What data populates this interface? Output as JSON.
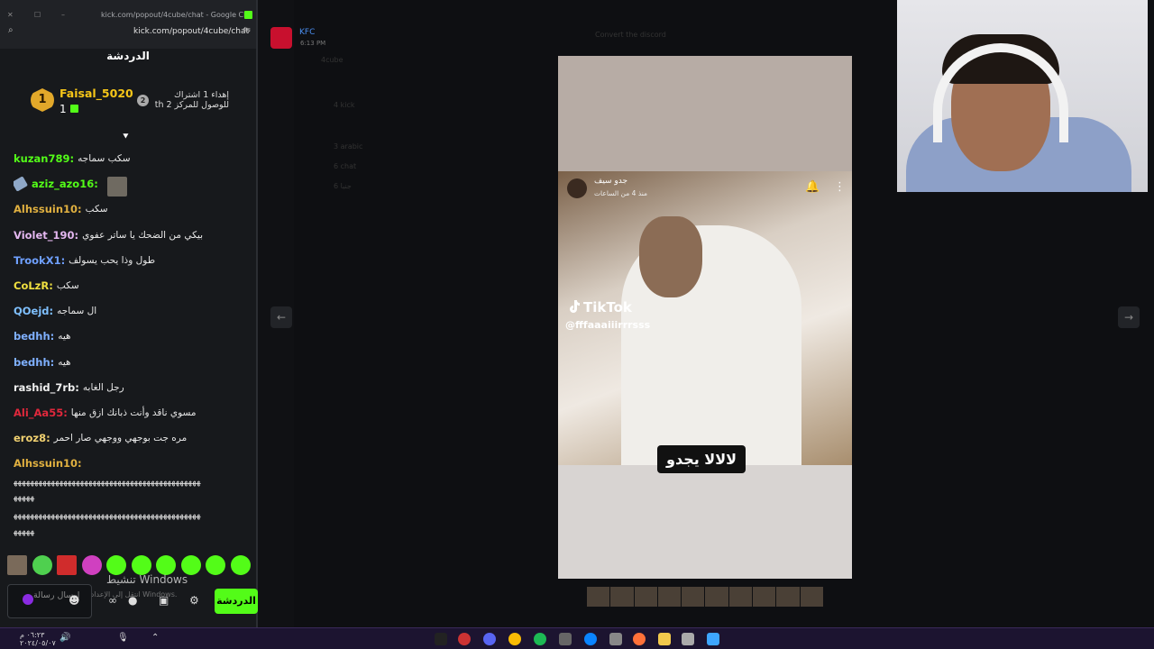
{
  "browser": {
    "window_title": "kick.com/popout/4cube/chat - Google Chrome",
    "url": "kick.com/popout/4cube/chat",
    "zoom_icon": "zoom-icon",
    "extension_icon": "extension-icon"
  },
  "chat": {
    "header": "الدردشة",
    "leader": {
      "rank": "1",
      "name": "Faisal_5020",
      "count": "1"
    },
    "gift_rank": "2",
    "gift_text": "إهداء 1 اشتراك للوصول للمركز 2 th",
    "messages": [
      {
        "user": "kuzan789:",
        "color": "#53fc18",
        "text": "سكب سماجه"
      },
      {
        "user": "aziz_azo16:",
        "color": "#53fc18",
        "text": "",
        "badge": true,
        "emote": true
      },
      {
        "user": "Alhssuin10:",
        "color": "#e0b040",
        "text": "سكب"
      },
      {
        "user": "Violet_190:",
        "color": "#e4b7f0",
        "text": "بيكي من الضحك يا ساتر عفوي"
      },
      {
        "user": "TrookX1:",
        "color": "#6fa0ff",
        "text": "طول وذا يحب يسولف"
      },
      {
        "user": "CoLzR:",
        "color": "#f0e040",
        "text": "سكب"
      },
      {
        "user": "QOejd:",
        "color": "#7fc0ff",
        "text": "ال سماجه"
      },
      {
        "user": "bedhh:",
        "color": "#7fb0ff",
        "text": "هيه"
      },
      {
        "user": "bedhh:",
        "color": "#7fb0ff",
        "text": "هيه"
      },
      {
        "user": "rashid_7rb:",
        "color": "#f0f0f0",
        "text": "رجل الغابه"
      },
      {
        "user": "Ali_Aa55:",
        "color": "#e0283c",
        "text": "مسوي ناقد وأنت ذبانك ازق منها"
      },
      {
        "user": "eroz8:",
        "color": "#f0d070",
        "text": "مره جت بوجهي ووجهي صار احمر"
      },
      {
        "user": "Alhssuin10:",
        "color": "#e0b040",
        "text": ""
      }
    ],
    "spam_lines": [
      "ﻬﻬﻬﻬﻬﻬﻬﻬﻬﻬﻬﻬﻬﻬﻬﻬﻬﻬﻬﻬﻬﻬﻬﻬﻬﻬﻬﻬﻬﻬﻬﻬﻬﻬﻬﻬﻬﻬﻬﻬﻬﻬﻬﻬﻬ",
      "ﻬﻬﻬﻬﻬ",
      "ﻬﻬﻬﻬﻬﻬﻬﻬﻬﻬﻬﻬﻬﻬﻬﻬﻬﻬﻬﻬﻬﻬﻬﻬﻬﻬﻬﻬﻬﻬﻬﻬﻬﻬﻬﻬﻬﻬﻬﻬﻬﻬﻬﻬﻬ",
      "ﻬﻬﻬﻬﻬ"
    ],
    "send_placeholder": "إرسال رسالة",
    "chat_button": "الدردشة",
    "windows_watermark": "تنشيط Windows",
    "windows_watermark_sub": "انتقل إلى الإعدادات لتنشيط Windows."
  },
  "stream": {
    "discord_user": "KFC",
    "discord_time": "6:13 PM",
    "dim_texts": [
      "4cube",
      "Convert the discord",
      "4 kick",
      "3 arabic",
      "6 chat",
      "6 جنبا"
    ],
    "video": {
      "poster_name": "جدو سيف",
      "poster_sub": "منذ 4 من الساعات",
      "tiktok_label": "TikTok",
      "tiktok_handle": "@fffaaaiiirrrsss",
      "caption": "لالالا يجدو"
    }
  },
  "taskbar": {
    "time": "٠٦:٢٣ م",
    "date": "٢٠٢٤/٠٥/٠٧"
  }
}
